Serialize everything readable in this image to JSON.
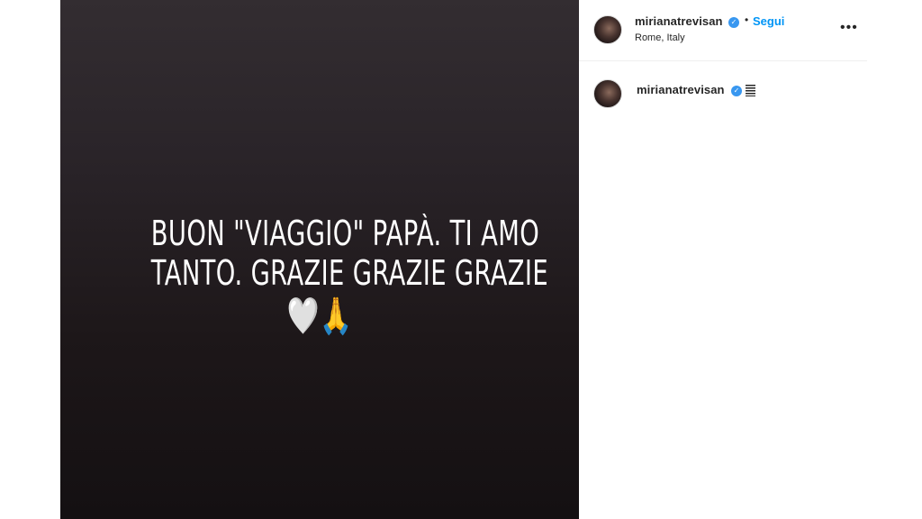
{
  "post": {
    "caption_lines": [
      "BUON \"VIAGGIO\" PAPÀ. TI AMO",
      "TANTO. GRAZIE GRAZIE GRAZIE"
    ],
    "emoji_heart": "🤍",
    "emoji_pray": "🙏"
  },
  "header": {
    "username": "mirianatrevisan",
    "verified_glyph": "✓",
    "separator": "•",
    "follow_label": "Segui",
    "location": "Rome, Italy",
    "more_glyph": "•••"
  },
  "comment": {
    "username": "mirianatrevisan",
    "verified_glyph": "✓"
  },
  "icons": {
    "verified": "verified-badge-icon",
    "more": "more-options-icon",
    "bars": "bars-icon"
  },
  "colors": {
    "accent": "#0095f6",
    "verified": "#3897f0",
    "text": "#262626"
  }
}
